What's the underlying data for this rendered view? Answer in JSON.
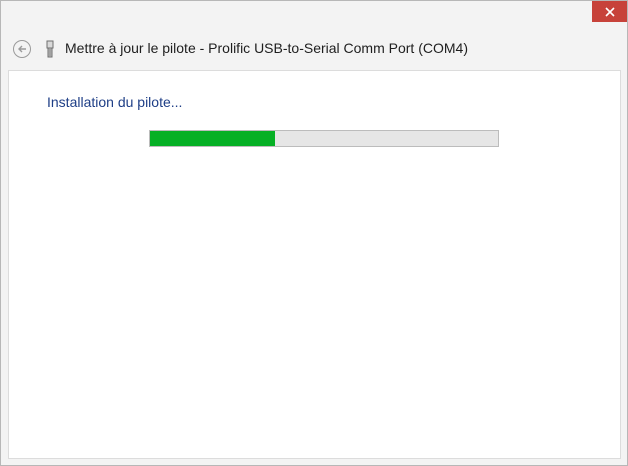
{
  "window": {
    "title": "Mettre à jour le pilote - Prolific USB-to-Serial Comm Port (COM4)",
    "close_icon": "close-icon",
    "back_icon": "back-arrow-icon",
    "app_icon": "usb-device-icon"
  },
  "content": {
    "heading": "Installation du pilote..."
  },
  "progress": {
    "fraction": 0.36,
    "color": "#06b025"
  },
  "colors": {
    "close_button": "#c7423a",
    "heading": "#1e3e86"
  }
}
